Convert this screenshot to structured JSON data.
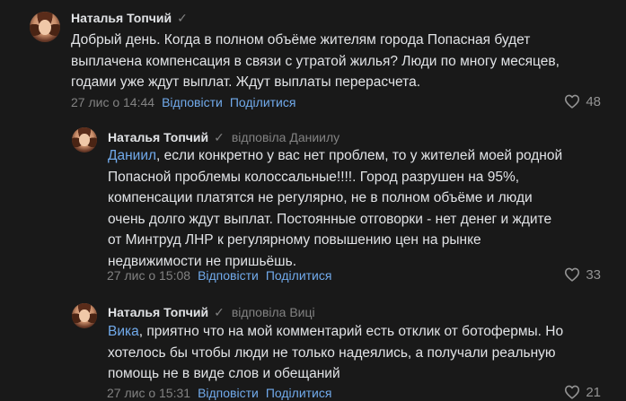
{
  "comments": [
    {
      "author": "Наталья Топчий",
      "reply_to": "",
      "mention": "",
      "text_lines": [
        "Добрый день. Когда в полном объёме жителям города Попасная будет",
        "выплачена компенсация в связи с утратой жилья? Люди по многу месяцев,",
        "годами уже ждут выплат. Ждут выплаты перерасчета."
      ],
      "timestamp": "27 лис о 14:44",
      "reply_label": "Відповісти",
      "share_label": "Поділитися",
      "likes": "48"
    },
    {
      "author": "Наталья Топчий",
      "reply_to": "відповіла Даниилу",
      "mention": "Даниил",
      "text_lines": [
        ", если конкретно у вас нет проблем, то у жителей моей родной",
        "Попасной проблемы колоссальные!!!!. Город разрушен на 95%,",
        "компенсации платятся не регулярно, не в полном объёме и люди",
        "очень долго ждут выплат. Постоянные отговорки - нет денег и ждите",
        "от Минтруд ЛНР к регулярному повышению цен на рынке",
        "недвижимости не пришьёшь."
      ],
      "timestamp": "27 лис о 15:08",
      "reply_label": "Відповісти",
      "share_label": "Поділитися",
      "likes": "33"
    },
    {
      "author": "Наталья Топчий",
      "reply_to": "відповіла Виці",
      "mention": "Вика",
      "text_lines": [
        ", приятно что на мой комментарий есть отклик от ботофермы. Но",
        "хотелось бы чтобы люди не только надеялись, а получали реальную",
        "помощь не в виде слов и обещаний"
      ],
      "timestamp": "27 лис о 15:31",
      "reply_label": "Відповісти",
      "share_label": "Поділитися",
      "likes": "21"
    }
  ]
}
